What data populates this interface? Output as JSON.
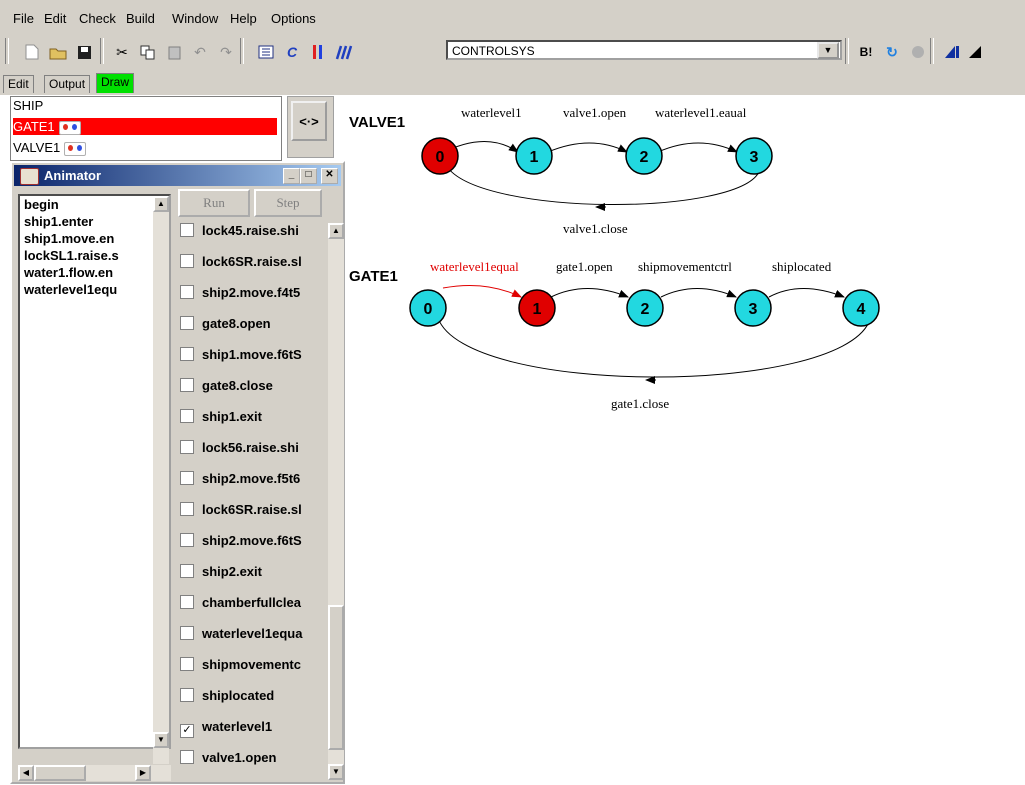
{
  "menu": [
    "File",
    "Edit",
    "Check",
    "Build",
    "Window",
    "Help",
    "Options"
  ],
  "toolbar": {
    "process_selected": "CONTROLSYS",
    "colors": {
      "draw_tab": "#00e000",
      "selected": "#ff0000",
      "node_default": "#22d8e0",
      "node_current": "#e00000"
    }
  },
  "tabs": [
    "Edit",
    "Output",
    "Draw"
  ],
  "active_tab": "Draw",
  "processes": [
    {
      "name": "SHIP",
      "icon": ""
    },
    {
      "name": "GATE1",
      "icon": "process-icon",
      "selected": true
    },
    {
      "name": "VALVE1",
      "icon": "process-icon"
    }
  ],
  "splitter": {
    "label": "<·>"
  },
  "animator": {
    "title": "Animator",
    "run_label": "Run",
    "step_label": "Step",
    "trace": [
      "begin",
      "ship1.enter",
      "ship1.move.en",
      "lockSL1.raise.s",
      "water1.flow.en",
      "waterlevel1equ"
    ],
    "actions": [
      {
        "label": "lock45.raise.shi",
        "checked": false
      },
      {
        "label": "lock6SR.raise.sl",
        "checked": false
      },
      {
        "label": "ship2.move.f4t5",
        "checked": false
      },
      {
        "label": "gate8.open",
        "checked": false
      },
      {
        "label": "ship1.move.f6tS",
        "checked": false
      },
      {
        "label": "gate8.close",
        "checked": false
      },
      {
        "label": "ship1.exit",
        "checked": false
      },
      {
        "label": "lock56.raise.shi",
        "checked": false
      },
      {
        "label": "ship2.move.f5t6",
        "checked": false
      },
      {
        "label": "lock6SR.raise.sl",
        "checked": false
      },
      {
        "label": "ship2.move.f6tS",
        "checked": false
      },
      {
        "label": "ship2.exit",
        "checked": false
      },
      {
        "label": "chamberfullclea",
        "checked": false
      },
      {
        "label": "waterlevel1equa",
        "checked": false
      },
      {
        "label": "shipmovementc",
        "checked": false
      },
      {
        "label": "shiplocated",
        "checked": false
      },
      {
        "label": "waterlevel1",
        "checked": true
      },
      {
        "label": "valve1.open",
        "checked": false
      }
    ]
  },
  "diagram": {
    "valve": {
      "name": "VALVE1",
      "states": [
        "0",
        "1",
        "2",
        "3"
      ],
      "current": 0,
      "transitions": [
        "waterlevel1",
        "valve1.open",
        "waterlevel1.eaual"
      ],
      "back": "valve1.close"
    },
    "gate": {
      "name": "GATE1",
      "states": [
        "0",
        "1",
        "2",
        "3",
        "4"
      ],
      "current": 1,
      "transitions": [
        "waterlevel1equal",
        "gate1.open",
        "shipmovementctrl",
        "shiplocated"
      ],
      "back": "gate1.close"
    }
  }
}
